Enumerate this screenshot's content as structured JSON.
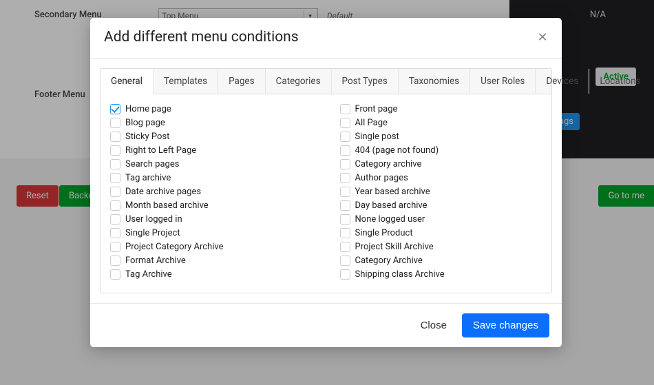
{
  "background": {
    "secondary_menu_label": "Secondary Menu",
    "footer_menu_label": "Footer Menu",
    "select_value": "Top Menu",
    "default_label": "Default",
    "na_label": "N/A",
    "active_label": "Active",
    "blue_btn_fragment": "ings",
    "reset_label": "Reset",
    "backup_label_fragment": "Backu",
    "goto_label_fragment": "Go to me"
  },
  "modal": {
    "title": "Add different menu conditions",
    "tabs": [
      "General",
      "Templates",
      "Pages",
      "Categories",
      "Post Types",
      "Taxonomies",
      "User Roles",
      "Devices",
      "Locations"
    ],
    "active_tab": "General",
    "columns": [
      [
        {
          "label": "Home page",
          "checked": true
        },
        {
          "label": "Blog page",
          "checked": false
        },
        {
          "label": "Sticky Post",
          "checked": false
        },
        {
          "label": "Right to Left Page",
          "checked": false
        },
        {
          "label": "Search pages",
          "checked": false
        },
        {
          "label": "Tag archive",
          "checked": false
        },
        {
          "label": "Date archive pages",
          "checked": false
        },
        {
          "label": "Month based archive",
          "checked": false
        },
        {
          "label": "User logged in",
          "checked": false
        },
        {
          "label": "Single Project",
          "checked": false
        },
        {
          "label": "Project Category Archive",
          "checked": false
        },
        {
          "label": "Format Archive",
          "checked": false
        },
        {
          "label": "Tag Archive",
          "checked": false
        }
      ],
      [
        {
          "label": "Front page",
          "checked": false
        },
        {
          "label": "All Page",
          "checked": false
        },
        {
          "label": "Single post",
          "checked": false
        },
        {
          "label": "404 (page not found)",
          "checked": false
        },
        {
          "label": "Category archive",
          "checked": false
        },
        {
          "label": "Author pages",
          "checked": false
        },
        {
          "label": "Year based archive",
          "checked": false
        },
        {
          "label": "Day based archive",
          "checked": false
        },
        {
          "label": "None logged user",
          "checked": false
        },
        {
          "label": "Single Product",
          "checked": false
        },
        {
          "label": "Project Skill Archive",
          "checked": false
        },
        {
          "label": "Category Archive",
          "checked": false
        },
        {
          "label": "Shipping class Archive",
          "checked": false
        }
      ]
    ],
    "close_label": "Close",
    "save_label": "Save changes"
  }
}
